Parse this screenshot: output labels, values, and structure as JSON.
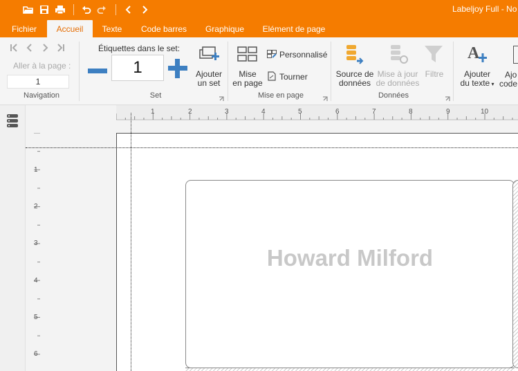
{
  "window": {
    "title": "Labeljoy Full - No",
    "accent_color": "#f57c00"
  },
  "quick_access": {
    "items": [
      "open-icon",
      "save-icon",
      "print-icon",
      "undo-icon",
      "redo-icon",
      "back-icon",
      "forward-icon"
    ]
  },
  "tabs": [
    {
      "label": "Fichier",
      "active": false
    },
    {
      "label": "Accueil",
      "active": true
    },
    {
      "label": "Texte",
      "active": false
    },
    {
      "label": "Code barres",
      "active": false
    },
    {
      "label": "Graphique",
      "active": false
    },
    {
      "label": "Elément de page",
      "active": false
    }
  ],
  "ribbon": {
    "navigation": {
      "go_to_page_label": "Aller à la page :",
      "page_value": "1",
      "group_label": "Navigation"
    },
    "set": {
      "labels_in_set_label": "Étiquettes dans le set:",
      "count_value": "1",
      "add_set_label_1": "Ajouter",
      "add_set_label_2": "un set",
      "group_label": "Set"
    },
    "layout": {
      "layout_label_1": "Mise",
      "layout_label_2": "en page",
      "custom_label": "Personnalisé",
      "rotate_label": "Tourner",
      "group_label": "Mise en page"
    },
    "data": {
      "source_label_1": "Source de",
      "source_label_2": "données",
      "update_label_1": "Mise à jour",
      "update_label_2": "de données",
      "filter_label": "Filtre",
      "group_label": "Données"
    },
    "insert": {
      "add_text_label_1": "Ajouter",
      "add_text_label_2": "du texte",
      "add_code_label_1": "Ajo",
      "add_code_label_2": "code"
    }
  },
  "rulers": {
    "horizontal": [
      "1",
      "2",
      "3",
      "4",
      "5",
      "6",
      "7",
      "8",
      "9",
      "10"
    ],
    "vertical": [
      "1",
      "2",
      "3",
      "4",
      "5",
      "6"
    ]
  },
  "canvas": {
    "label_text": "Howard Milford"
  }
}
